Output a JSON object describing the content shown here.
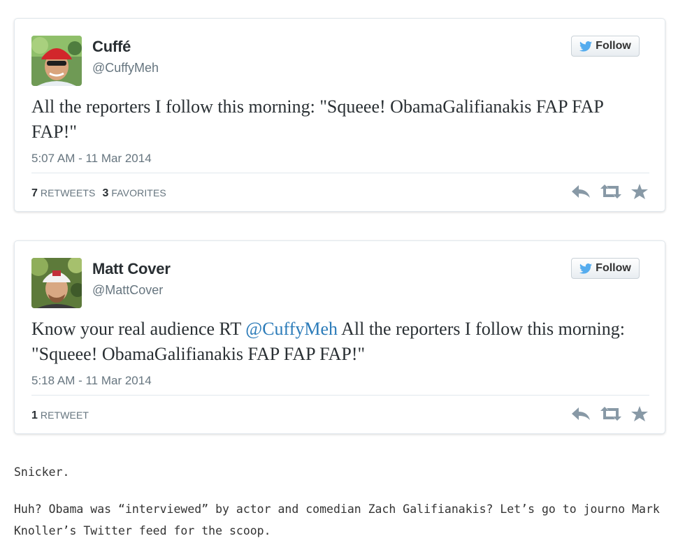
{
  "tweets": [
    {
      "name": "Cuffé",
      "handle": "@CuffyMeh",
      "follow_label": "Follow",
      "text_parts": [
        "All the reporters I follow this morning: \"Squeee! ObamaGalifianakis FAP FAP FAP!\""
      ],
      "timestamp": "5:07 AM - 11 Mar 2014",
      "stats": [
        {
          "count": "7",
          "label": "Retweets"
        },
        {
          "count": "3",
          "label": "Favorites"
        }
      ]
    },
    {
      "name": "Matt Cover",
      "handle": "@MattCover",
      "follow_label": "Follow",
      "text_before": "Know your real audience RT ",
      "text_mention": "@CuffyMeh",
      "text_after": " All the reporters I follow this morning: \"Squeee! ObamaGalifianakis FAP FAP FAP!\"",
      "timestamp": "5:18 AM - 11 Mar 2014",
      "stats": [
        {
          "count": "1",
          "label": "Retweet"
        }
      ]
    }
  ],
  "icons": {
    "follow": "twitter-bird-icon",
    "reply": "reply-icon",
    "retweet": "retweet-icon",
    "favorite": "star-icon"
  },
  "colors": {
    "mention": "#2b7bb9",
    "twitter_blue": "#55acee",
    "action_gray": "#8899a6"
  },
  "paragraphs": [
    "Snicker.",
    "Huh? Obama was “interviewed” by actor and comedian Zach Galifianakis? Let’s go to journo Mark Knoller’s Twitter feed for the scoop."
  ]
}
